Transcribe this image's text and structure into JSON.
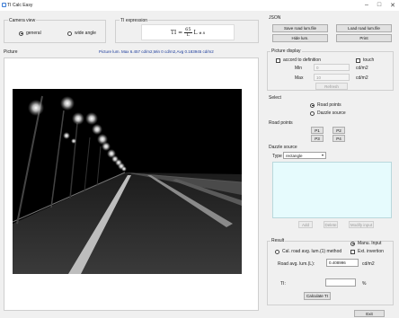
{
  "window": {
    "title": "TI Calc Easy"
  },
  "camera_view": {
    "title": "Camera view",
    "options": [
      "general",
      "wide angle"
    ],
    "selected": 0
  },
  "ti_expression": {
    "title": "TI expression",
    "formula_lhs": "TI =",
    "formula_num": "65",
    "formula_den": "L",
    "formula_rhs": "L",
    "formula_exp": "0.8",
    "formula_sub": "v"
  },
  "picture": {
    "title": "Picture",
    "stats": "Picture lum. Max 6.457 cd/m2,Min 0 cd/m2,Avg 0.183945 cd/m2"
  },
  "json": {
    "title": "JSON",
    "save_button": "Save road lum.file",
    "load_button": "Load road lum.file",
    "hide_button": "Hide lum.",
    "print_button": "Print"
  },
  "picture_display": {
    "title": "Picture display",
    "accord_label": "accord to definition",
    "touch_label": "touch",
    "min_label": "Min",
    "max_label": "Max",
    "min_value": "0",
    "max_value": "10",
    "unit": "cd/m2",
    "refresh_button": "Refresh"
  },
  "select": {
    "title": "Select",
    "options": [
      "Road points",
      "Dazzle source"
    ],
    "selected": 0
  },
  "road_points": {
    "title": "Road points",
    "buttons": [
      "P1",
      "P2",
      "P3",
      "P4"
    ]
  },
  "dazzle_source": {
    "title": "Dazzle source",
    "type_label": "Type",
    "type_value": "rectangle",
    "buttons": [
      "Add",
      "Delete",
      "Modify input"
    ]
  },
  "result": {
    "title": "Result",
    "method_label": "Cal. road avg. lum.(1) method",
    "manual_label": "Manu. Input",
    "ext_label": "Ext. invertion",
    "road_label": "Road avg. lum.(L):",
    "road_value": "0.408996",
    "unit": "cd/m2",
    "ti_label": "TI:",
    "ti_value": "",
    "ti_unit": "%",
    "calc_button": "Calculate TI"
  },
  "exit_button": "Exit"
}
